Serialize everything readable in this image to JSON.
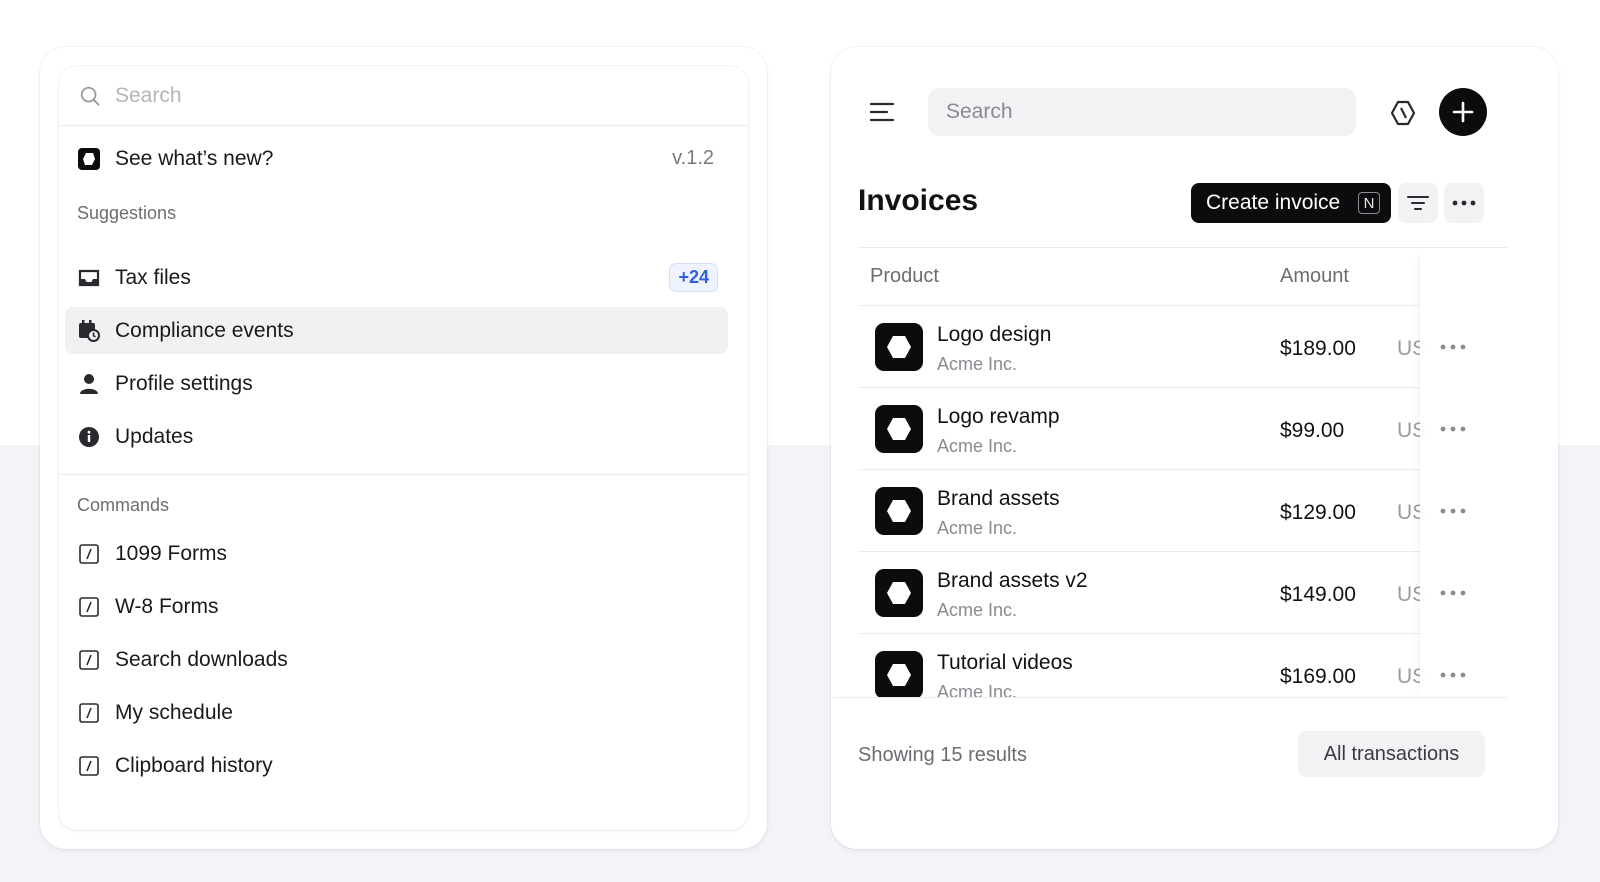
{
  "palette": {
    "search_placeholder": "Search",
    "whats_new": {
      "label": "See what’s new?",
      "version": "v.1.2"
    },
    "suggestions_title": "Suggestions",
    "suggestions": [
      {
        "label": "Tax files",
        "icon": "inbox-icon",
        "badge": "+24"
      },
      {
        "label": "Compliance events",
        "icon": "calendar-clock-icon",
        "active": true
      },
      {
        "label": "Profile settings",
        "icon": "user-icon"
      },
      {
        "label": "Updates",
        "icon": "info-icon"
      }
    ],
    "commands_title": "Commands",
    "commands": [
      {
        "label": "1099 Forms",
        "icon": "slash-command-icon"
      },
      {
        "label": "W-8 Forms",
        "icon": "slash-command-icon"
      },
      {
        "label": "Search downloads",
        "icon": "slash-command-icon"
      },
      {
        "label": "My schedule",
        "icon": "slash-command-icon"
      },
      {
        "label": "Clipboard history",
        "icon": "slash-command-icon"
      }
    ]
  },
  "invoices": {
    "search_placeholder": "Search",
    "title": "Invoices",
    "create_label": "Create invoice",
    "create_shortcut": "N",
    "columns": {
      "product": "Product",
      "amount": "Amount"
    },
    "rows": [
      {
        "name": "Logo design",
        "company": "Acme Inc.",
        "amount": "$189.00",
        "currency": "US"
      },
      {
        "name": "Logo revamp",
        "company": "Acme Inc.",
        "amount": "$99.00",
        "currency": "US"
      },
      {
        "name": "Brand assets",
        "company": "Acme Inc.",
        "amount": "$129.00",
        "currency": "US"
      },
      {
        "name": "Brand assets v2",
        "company": "Acme Inc.",
        "amount": "$149.00",
        "currency": "US"
      },
      {
        "name": "Tutorial videos",
        "company": "Acme Inc.",
        "amount": "$169.00",
        "currency": "US"
      }
    ],
    "footer_text": "Showing 15 results",
    "all_transactions_label": "All transactions"
  },
  "colors": {
    "primary_dark": "#0c0c0e",
    "badge_blue": "#2f5fe0",
    "background_lower": "#f4f3f8"
  }
}
